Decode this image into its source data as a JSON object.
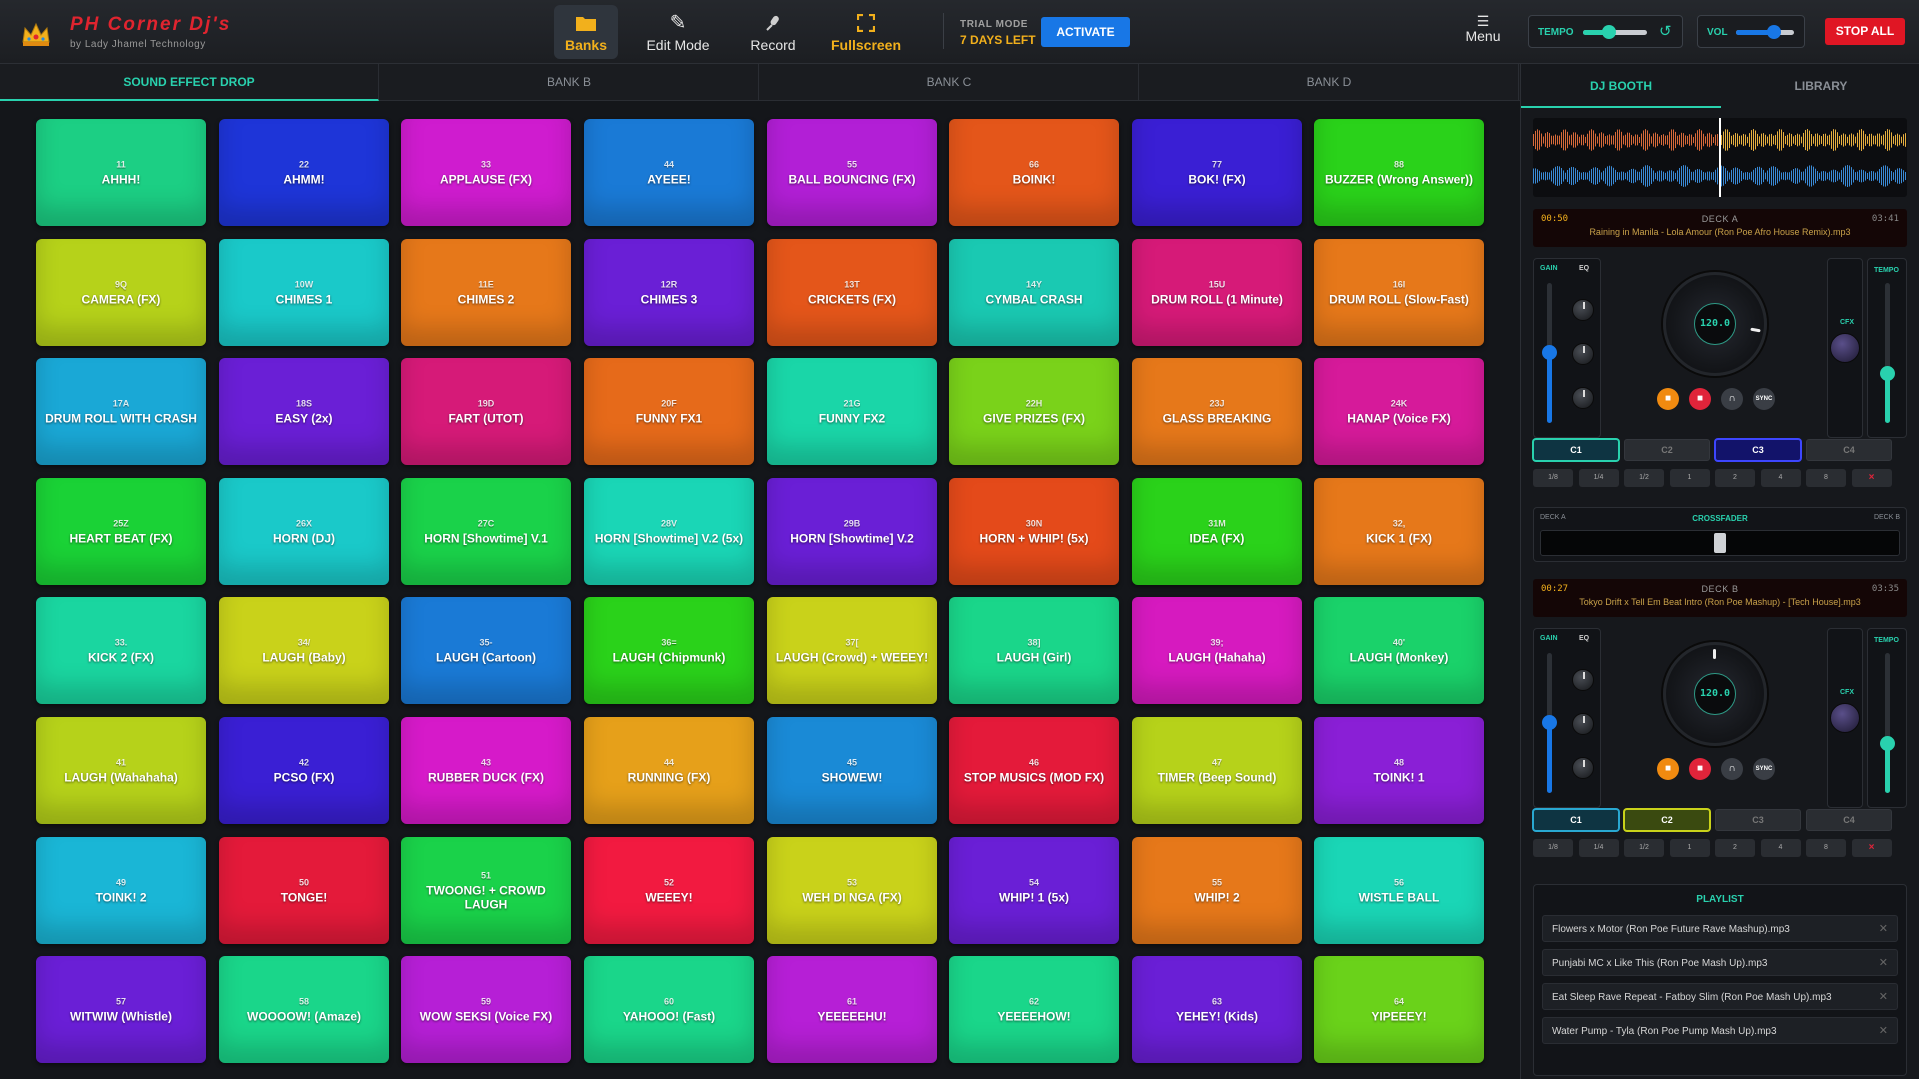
{
  "app": {
    "title": "PH Corner Dj's",
    "subtitle": "by Lady Jhamel Technology",
    "logo_icon": "crown-icon"
  },
  "toolbar": {
    "banks": {
      "label": "Banks",
      "icon": "folder-icon"
    },
    "edit": {
      "label": "Edit Mode",
      "icon": "pencil-icon"
    },
    "record": {
      "label": "Record",
      "icon": "microphone-icon"
    },
    "fullscreen": {
      "label": "Fullscreen",
      "icon": "expand-icon"
    },
    "trial_label": "TRIAL MODE",
    "trial_days": "7 DAYS LEFT",
    "activate": "ACTIVATE",
    "menu_label": "Menu",
    "tempo_label": "TEMPO",
    "tempo_level": 0.4,
    "vol_label": "VOL",
    "vol_level": 0.65,
    "stop_all": "STOP ALL"
  },
  "bank_tabs": [
    "SOUND EFFECT DROP",
    "BANK B",
    "BANK C",
    "BANK D"
  ],
  "active_bank": 0,
  "pads": [
    {
      "key": "11",
      "name": "AHHH!",
      "color": "#1ccf84"
    },
    {
      "key": "22",
      "name": "AHMM!",
      "color": "#1e35d8"
    },
    {
      "key": "33",
      "name": "APPLAUSE (FX)",
      "color": "#cf1ccf"
    },
    {
      "key": "44",
      "name": "AYEEE!",
      "color": "#1a7ad6"
    },
    {
      "key": "55",
      "name": "BALL BOUNCING (FX)",
      "color": "#b21fd6"
    },
    {
      "key": "66",
      "name": "BOINK!",
      "color": "#e4561a"
    },
    {
      "key": "77",
      "name": "BOK! (FX)",
      "color": "#3a1fd4"
    },
    {
      "key": "88",
      "name": "BUZZER (Wrong Answer))",
      "color": "#2ad21a"
    },
    {
      "key": "9Q",
      "name": "CAMERA (FX)",
      "color": "#b6d21a"
    },
    {
      "key": "10W",
      "name": "CHIMES 1",
      "color": "#1ac9c9"
    },
    {
      "key": "11E",
      "name": "CHIMES 2",
      "color": "#e6781a"
    },
    {
      "key": "12R",
      "name": "CHIMES 3",
      "color": "#6a1fd6"
    },
    {
      "key": "13T",
      "name": "CRICKETS (FX)",
      "color": "#e4561a"
    },
    {
      "key": "14Y",
      "name": "CYMBAL CRASH",
      "color": "#1ac9b2"
    },
    {
      "key": "15U",
      "name": "DRUM ROLL (1 Minute)",
      "color": "#d61a78"
    },
    {
      "key": "16I",
      "name": "DRUM ROLL (Slow-Fast)",
      "color": "#e6781a"
    },
    {
      "key": "17A",
      "name": "DRUM ROLL WITH CRASH",
      "color": "#1aa8d6"
    },
    {
      "key": "18S",
      "name": "EASY (2x)",
      "color": "#6a1fd6"
    },
    {
      "key": "19D",
      "name": "FART (UTOT)",
      "color": "#d61a78"
    },
    {
      "key": "20F",
      "name": "FUNNY FX1",
      "color": "#e66a1a"
    },
    {
      "key": "21G",
      "name": "FUNNY FX2",
      "color": "#1ad6a8"
    },
    {
      "key": "22H",
      "name": "GIVE PRIZES (FX)",
      "color": "#7ad21a"
    },
    {
      "key": "23J",
      "name": "GLASS BREAKING",
      "color": "#e6781a"
    },
    {
      "key": "24K",
      "name": "HANAP (Voice FX)",
      "color": "#d61a9a"
    },
    {
      "key": "25Z",
      "name": "HEART BEAT (FX)",
      "color": "#1ad236"
    },
    {
      "key": "26X",
      "name": "HORN (DJ)",
      "color": "#1ac9c9"
    },
    {
      "key": "27C",
      "name": "HORN [Showtime] V.1",
      "color": "#1ad24a"
    },
    {
      "key": "28V",
      "name": "HORN [Showtime] V.2 (5x)",
      "color": "#1ad6b6"
    },
    {
      "key": "29B",
      "name": "HORN [Showtime] V.2",
      "color": "#6a1fd6"
    },
    {
      "key": "30N",
      "name": "HORN + WHIP! (5x)",
      "color": "#e44a1a"
    },
    {
      "key": "31M",
      "name": "IDEA (FX)",
      "color": "#2ad21a"
    },
    {
      "key": "32,",
      "name": "KICK 1 (FX)",
      "color": "#e6781a"
    },
    {
      "key": "33.",
      "name": "KICK 2 (FX)",
      "color": "#1ad6a0"
    },
    {
      "key": "34/",
      "name": "LAUGH (Baby)",
      "color": "#c9d21a"
    },
    {
      "key": "35-",
      "name": "LAUGH (Cartoon)",
      "color": "#1a7ad6"
    },
    {
      "key": "36=",
      "name": "LAUGH (Chipmunk)",
      "color": "#2ad21a"
    },
    {
      "key": "37[",
      "name": "LAUGH (Crowd) + WEEEY!",
      "color": "#c9d21a"
    },
    {
      "key": "38]",
      "name": "LAUGH (Girl)",
      "color": "#1ad68a"
    },
    {
      "key": "39;",
      "name": "LAUGH (Hahaha)",
      "color": "#d61abf"
    },
    {
      "key": "40'",
      "name": "LAUGH (Monkey)",
      "color": "#1ad26a"
    },
    {
      "key": "41",
      "name": "LAUGH (Wahahaha)",
      "color": "#b6d21a"
    },
    {
      "key": "42",
      "name": "PCSO (FX)",
      "color": "#3a1fd4"
    },
    {
      "key": "43",
      "name": "RUBBER DUCK (FX)",
      "color": "#d61ac9"
    },
    {
      "key": "44",
      "name": "RUNNING (FX)",
      "color": "#e6a01a"
    },
    {
      "key": "45",
      "name": "SHOWEW!",
      "color": "#1a8ad6"
    },
    {
      "key": "46",
      "name": "STOP MUSICS (MOD FX)",
      "color": "#e41a3a"
    },
    {
      "key": "47",
      "name": "TIMER (Beep Sound)",
      "color": "#b6d21a"
    },
    {
      "key": "48",
      "name": "TOINK! 1",
      "color": "#8a1fd6"
    },
    {
      "key": "49",
      "name": "TOINK! 2",
      "color": "#1ab6d6"
    },
    {
      "key": "50",
      "name": "TONGE!",
      "color": "#e41a3a"
    },
    {
      "key": "51",
      "name": "TWOONG! + CROWD LAUGH",
      "color": "#1ad24a"
    },
    {
      "key": "52",
      "name": "WEEEY!",
      "color": "#f21a40"
    },
    {
      "key": "53",
      "name": "WEH DI NGA (FX)",
      "color": "#c9d21a"
    },
    {
      "key": "54",
      "name": "WHIP! 1 (5x)",
      "color": "#6a1fd6"
    },
    {
      "key": "55",
      "name": "WHIP! 2",
      "color": "#e6781a"
    },
    {
      "key": "56",
      "name": "WISTLE BALL",
      "color": "#1ad6b6"
    },
    {
      "key": "57",
      "name": "WITWIW (Whistle)",
      "color": "#6a1fd6"
    },
    {
      "key": "58",
      "name": "WOOOOW! (Amaze)",
      "color": "#1ad68a"
    },
    {
      "key": "59",
      "name": "WOW SEKSI (Voice FX)",
      "color": "#b61fd6"
    },
    {
      "key": "60",
      "name": "YAHOOO! (Fast)",
      "color": "#1ad68a"
    },
    {
      "key": "61",
      "name": "YEEEEEHU!",
      "color": "#b61fd6"
    },
    {
      "key": "62",
      "name": "YEEEEHOW!",
      "color": "#1ad68a"
    },
    {
      "key": "63",
      "name": "YEHEY! (Kids)",
      "color": "#6a1fd6"
    },
    {
      "key": "64",
      "name": "YIPEEEY!",
      "color": "#6ad21a"
    }
  ],
  "right_panel": {
    "tabs": [
      "DJ BOOTH",
      "LIBRARY"
    ],
    "deck_a": {
      "label": "DECK A",
      "time": "00:50",
      "total": "03:41",
      "track": "Raining in Manila - Lola Amour (Ron Poe Afro House Remix).mp3",
      "bpm": "120.0",
      "gain_label": "GAIN",
      "eq_label": "EQ",
      "cfx_label": "CFX",
      "tempo_label": "TEMPO",
      "gain_level": 0.5,
      "tempo_level": 0.35,
      "cues": [
        "C1",
        "C2",
        "C3",
        "C4"
      ],
      "loops": [
        "1/8",
        "1/4",
        "1/2",
        "1",
        "2",
        "4",
        "8",
        "×"
      ],
      "sync_label": "SYNC"
    },
    "deck_b": {
      "label": "DECK B",
      "time": "00:27",
      "total": "03:35",
      "track": "Tokyo Drift x Tell Em Beat Intro (Ron Poe Mashup) - [Tech House].mp3",
      "bpm": "120.0",
      "gain_label": "GAIN",
      "eq_label": "EQ",
      "cfx_label": "CFX",
      "tempo_label": "TEMPO",
      "gain_level": 0.5,
      "tempo_level": 0.35,
      "cues": [
        "C1",
        "C2",
        "C3",
        "C4"
      ],
      "loops": [
        "1/8",
        "1/4",
        "1/2",
        "1",
        "2",
        "4",
        "8",
        "×"
      ],
      "sync_label": "SYNC"
    },
    "crossfader": {
      "label": "CROSSFADER",
      "left": "DECK A",
      "right": "DECK B",
      "position": 0.5
    },
    "playlist": {
      "title": "PLAYLIST",
      "items": [
        "Flowers x Motor (Ron Poe Future Rave Mashup).mp3",
        "Punjabi MC x Like This (Ron Poe Mash Up).mp3",
        "Eat Sleep Rave Repeat - Fatboy Slim (Ron Poe Mash Up).mp3",
        "Water Pump - Tyla (Ron Poe Pump Mash Up).mp3"
      ]
    }
  }
}
